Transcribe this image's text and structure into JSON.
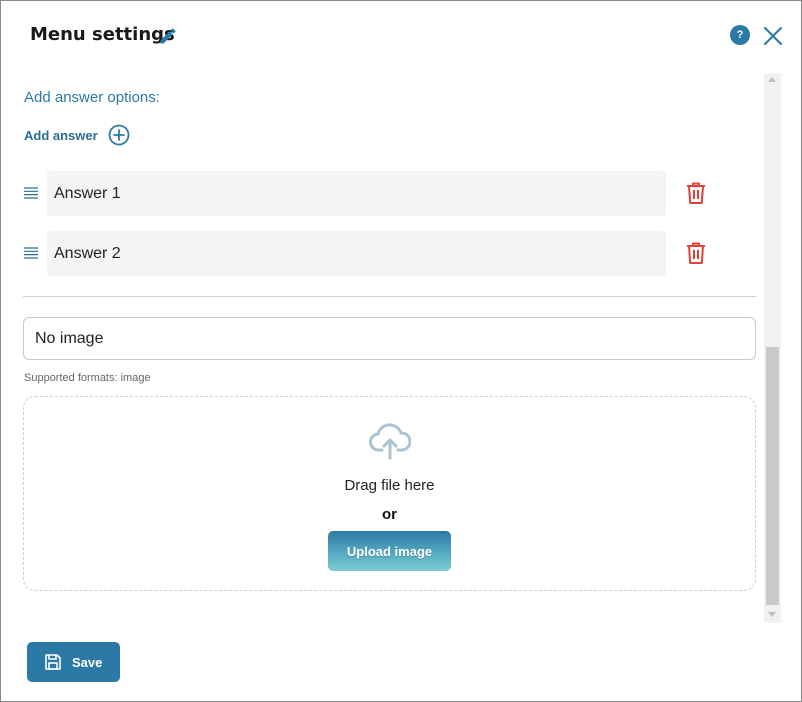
{
  "dialog": {
    "title": "Menu settings",
    "help_label": "?"
  },
  "answers": {
    "section_label": "Add answer options:",
    "add_label": "Add answer",
    "items": [
      {
        "value": "Answer 1"
      },
      {
        "value": "Answer 2"
      }
    ]
  },
  "image": {
    "select_value": "No image",
    "formats_hint": "Supported formats: image",
    "drop_text": "Drag file here",
    "or_text": "or",
    "upload_label": "Upload image"
  },
  "footer": {
    "save_label": "Save"
  },
  "colors": {
    "accent": "#2b7aa6",
    "delete": "#e0413b",
    "cloud": "#a9c3d3"
  },
  "icons": [
    "edit-icon",
    "help-icon",
    "close-icon",
    "plus-circle-icon",
    "drag-handle-icon",
    "trash-icon",
    "upload-cloud-icon",
    "save-icon"
  ]
}
